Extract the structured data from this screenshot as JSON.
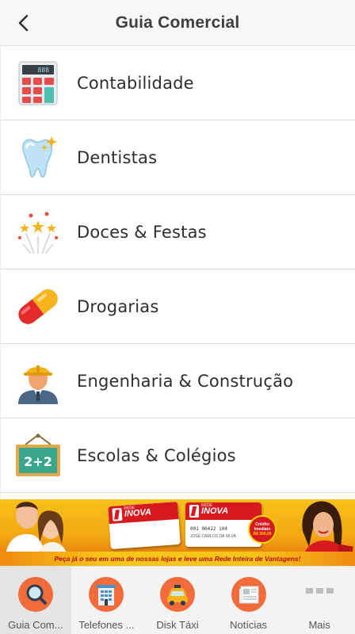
{
  "header": {
    "title": "Guia Comercial",
    "back_icon": "chevron-left-icon"
  },
  "categories": [
    {
      "label": "Contabilidade",
      "icon": "calculator-icon"
    },
    {
      "label": "Dentistas",
      "icon": "tooth-icon"
    },
    {
      "label": "Doces & Festas",
      "icon": "fireworks-icon"
    },
    {
      "label": "Drogarias",
      "icon": "pill-icon"
    },
    {
      "label": "Engenharia & Construção",
      "icon": "worker-icon"
    },
    {
      "label": "Escolas & Colégios",
      "icon": "chalkboard-icon"
    }
  ],
  "banner": {
    "brand": "INOVA",
    "brand_prefix": "REDE",
    "brand_sub": "DROGARIAS",
    "card_number": "001 00412 104",
    "card_name": "JOSÉ CARLOS DA SILVA",
    "credit_line1": "Crédito",
    "credit_line2": "Imediato",
    "credit_value": "R$ 200,00",
    "tagline": "Peça já o seu em uma de nossas lojas e leve uma Rede Inteira de Vantagens!"
  },
  "colors": {
    "accent": "#f26b3a",
    "brand_red": "#d71920",
    "header_bg": "#f7f7f7"
  },
  "tabs": [
    {
      "label": "Guia Com...",
      "icon": "search-icon",
      "active": true
    },
    {
      "label": "Telefones ...",
      "icon": "building-icon",
      "active": false
    },
    {
      "label": "Disk Táxi",
      "icon": "taxi-icon",
      "active": false
    },
    {
      "label": "Notícias",
      "icon": "newspaper-icon",
      "active": false
    },
    {
      "label": "Mais",
      "icon": "more-icon",
      "active": false
    }
  ]
}
